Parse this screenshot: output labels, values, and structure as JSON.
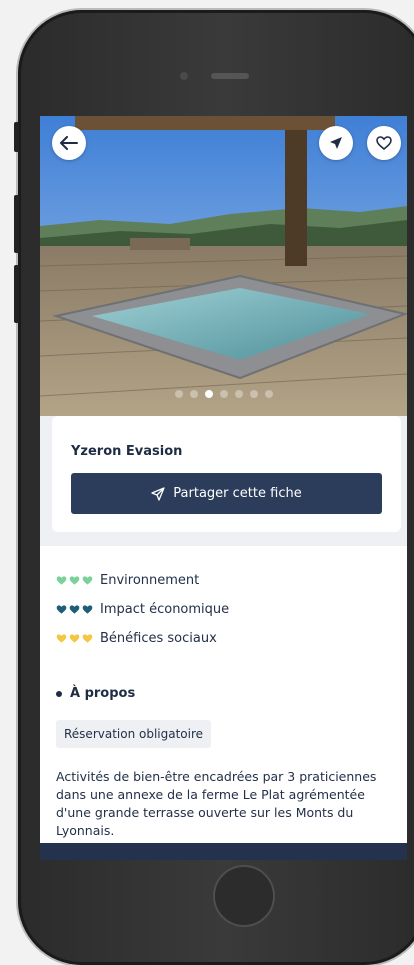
{
  "header": {
    "back_icon": "arrow-left-icon",
    "share_icon": "paper-plane-icon",
    "favorite_icon": "heart-outline-icon"
  },
  "gallery": {
    "photo_count": 7,
    "active_index": 2
  },
  "listing": {
    "title": "Yzeron Evasion",
    "share_button_label": "Partager cette fiche"
  },
  "impact": [
    {
      "label": "Environnement",
      "color": "#7bd19a",
      "level": 3
    },
    {
      "label": "Impact économique",
      "color": "#1e5f78",
      "level": 3
    },
    {
      "label": "Bénéfices sociaux",
      "color": "#f4c643",
      "level": 3
    }
  ],
  "about": {
    "title": "À propos",
    "tag": "Réservation obligatoire",
    "description": "Activités de bien-être encadrées par 3 praticiennes dans une annexe de la ferme Le Plat agrémentée d'une grande terrasse ouverte sur les Monts du Lyonnais."
  },
  "colors": {
    "primary": "#2c3c5b",
    "text": "#233049",
    "panel": "#eef0f3"
  }
}
